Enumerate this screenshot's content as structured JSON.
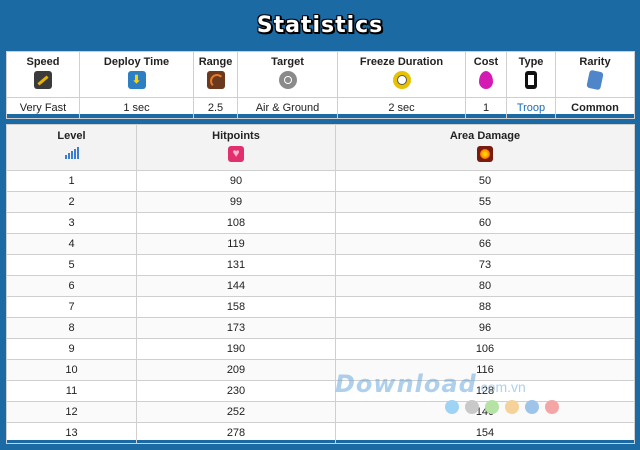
{
  "title": "Statistics",
  "stats": {
    "headers": [
      {
        "label": "Speed",
        "icon": "speed-icon"
      },
      {
        "label": "Deploy Time",
        "icon": "deploy-time-icon"
      },
      {
        "label": "Range",
        "icon": "range-icon"
      },
      {
        "label": "Target",
        "icon": "target-icon"
      },
      {
        "label": "Freeze Duration",
        "icon": "freeze-duration-icon"
      },
      {
        "label": "Cost",
        "icon": "elixir-icon"
      },
      {
        "label": "Type",
        "icon": "type-icon"
      },
      {
        "label": "Rarity",
        "icon": "rarity-icon"
      }
    ],
    "values": [
      "Very Fast",
      "1 sec",
      "2.5",
      "Air & Ground",
      "2 sec",
      "1",
      "Troop",
      "Common"
    ]
  },
  "levels": {
    "headers": [
      {
        "label": "Level",
        "icon": "level-bars-icon"
      },
      {
        "label": "Hitpoints",
        "icon": "heart-icon"
      },
      {
        "label": "Area Damage",
        "icon": "fire-icon"
      }
    ],
    "rows": [
      [
        "1",
        "90",
        "50"
      ],
      [
        "2",
        "99",
        "55"
      ],
      [
        "3",
        "108",
        "60"
      ],
      [
        "4",
        "119",
        "66"
      ],
      [
        "5",
        "131",
        "73"
      ],
      [
        "6",
        "144",
        "80"
      ],
      [
        "7",
        "158",
        "88"
      ],
      [
        "8",
        "173",
        "96"
      ],
      [
        "9",
        "190",
        "106"
      ],
      [
        "10",
        "209",
        "116"
      ],
      [
        "11",
        "230",
        "128"
      ],
      [
        "12",
        "252",
        "140"
      ],
      [
        "13",
        "278",
        "154"
      ]
    ]
  },
  "watermark": {
    "text": "Download",
    "suffix": ".com.vn",
    "dot_colors": [
      "#9fd3f5",
      "#c9c9c9",
      "#b6e3a5",
      "#f5d29a",
      "#9fc4ea",
      "#f4a5a5"
    ]
  },
  "colors": {
    "background": "#1c6aa3",
    "link": "#1a6bbd"
  }
}
